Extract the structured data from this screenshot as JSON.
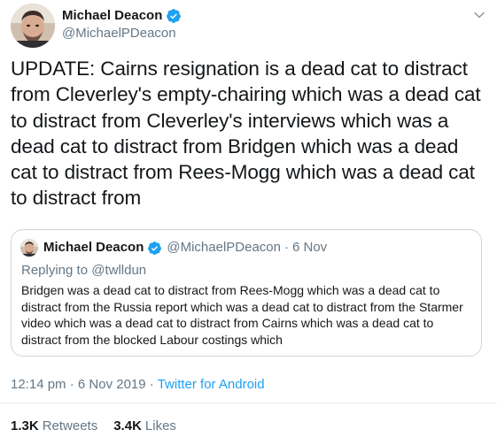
{
  "author": {
    "name": "Michael Deacon",
    "handle": "@MichaelPDeacon",
    "verified": true
  },
  "tweet_text": "UPDATE: Cairns resignation is a dead cat to distract from Cleverley's empty-chairing which was a dead cat to distract from Cleverley's interviews which was a dead cat to distract from Bridgen which was a dead cat to distract from Rees-Mogg which was a dead cat to distract from",
  "quoted_tweet": {
    "name": "Michael Deacon",
    "handle": "@MichaelPDeacon",
    "separator": "·",
    "date": "6 Nov",
    "replying_prefix": "Replying to",
    "replying_to": "@twlldun",
    "text": "Bridgen was a dead cat to distract from Rees-Mogg which was a dead cat to distract from the Russia report which was a dead cat to distract from the Starmer video which was a dead cat to distract from Cairns which was a dead cat to distract from the blocked Labour costings which"
  },
  "meta": {
    "time": "12:14 pm",
    "separator1": "·",
    "date": "6 Nov 2019",
    "separator2": "·",
    "source": "Twitter for Android"
  },
  "stats": {
    "retweets_count": "1.3K",
    "retweets_label": "Retweets",
    "likes_count": "3.4K",
    "likes_label": "Likes"
  },
  "colors": {
    "verified_badge": "#1da1f2",
    "link": "#1da1f2",
    "secondary_text": "#657786"
  }
}
